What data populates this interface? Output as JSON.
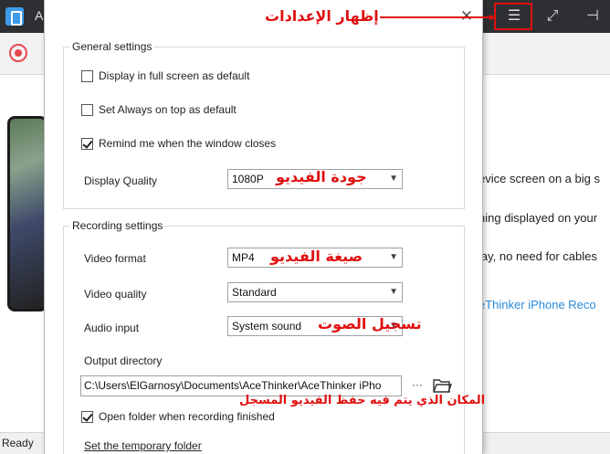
{
  "app": {
    "title_letter": "A",
    "status": "Ready"
  },
  "titlebar": {
    "settings_glyph": "☰",
    "expand_glyph": "⤢",
    "pin_glyph": "⊣"
  },
  "background": {
    "lines": [
      "evice screen on a big s",
      "hing displayed on your",
      "lay, no need for cables"
    ],
    "link": "eThinker iPhone Reco"
  },
  "dialog": {
    "close_glyph": "✕",
    "general": {
      "title": "General settings",
      "full_screen_label": "Display in full screen as default",
      "always_on_top_label": "Set Always on top as default",
      "remind_label": "Remind me when the window closes",
      "quality_label": "Display Quality",
      "quality_value": "1080P"
    },
    "recording": {
      "title": "Recording settings",
      "format_label": "Video format",
      "format_value": "MP4",
      "quality_label": "Video quality",
      "quality_value": "Standard",
      "audio_label": "Audio input",
      "audio_value": "System sound",
      "output_label": "Output directory",
      "output_value": "C:\\Users\\ElGarnosy\\Documents\\AceThinker\\AceThinker iPho",
      "browse_label": "···",
      "open_folder_label": "Open folder when recording finished",
      "temp_folder_link": "Set the temporary folder"
    }
  },
  "annotations": {
    "show_settings": "إظهار الإعدادات",
    "video_quality": "جودة الفيديو",
    "video_format": "صيغة الفيديو",
    "audio_recording": "تسجيل الصوت",
    "save_location": "المكان الذي يتم فيه حفظ الفيديو المسجل"
  },
  "colors": {
    "annotation": "#e01010",
    "titlebar": "#2e2f33",
    "link": "#2a8ad8"
  },
  "icons": {
    "app_logo": "phone-mirror-icon",
    "record": "record-icon",
    "settings": "list-menu-icon",
    "expand": "expand-icon",
    "pin": "pin-icon",
    "close": "close-icon",
    "folder": "folder-icon"
  }
}
